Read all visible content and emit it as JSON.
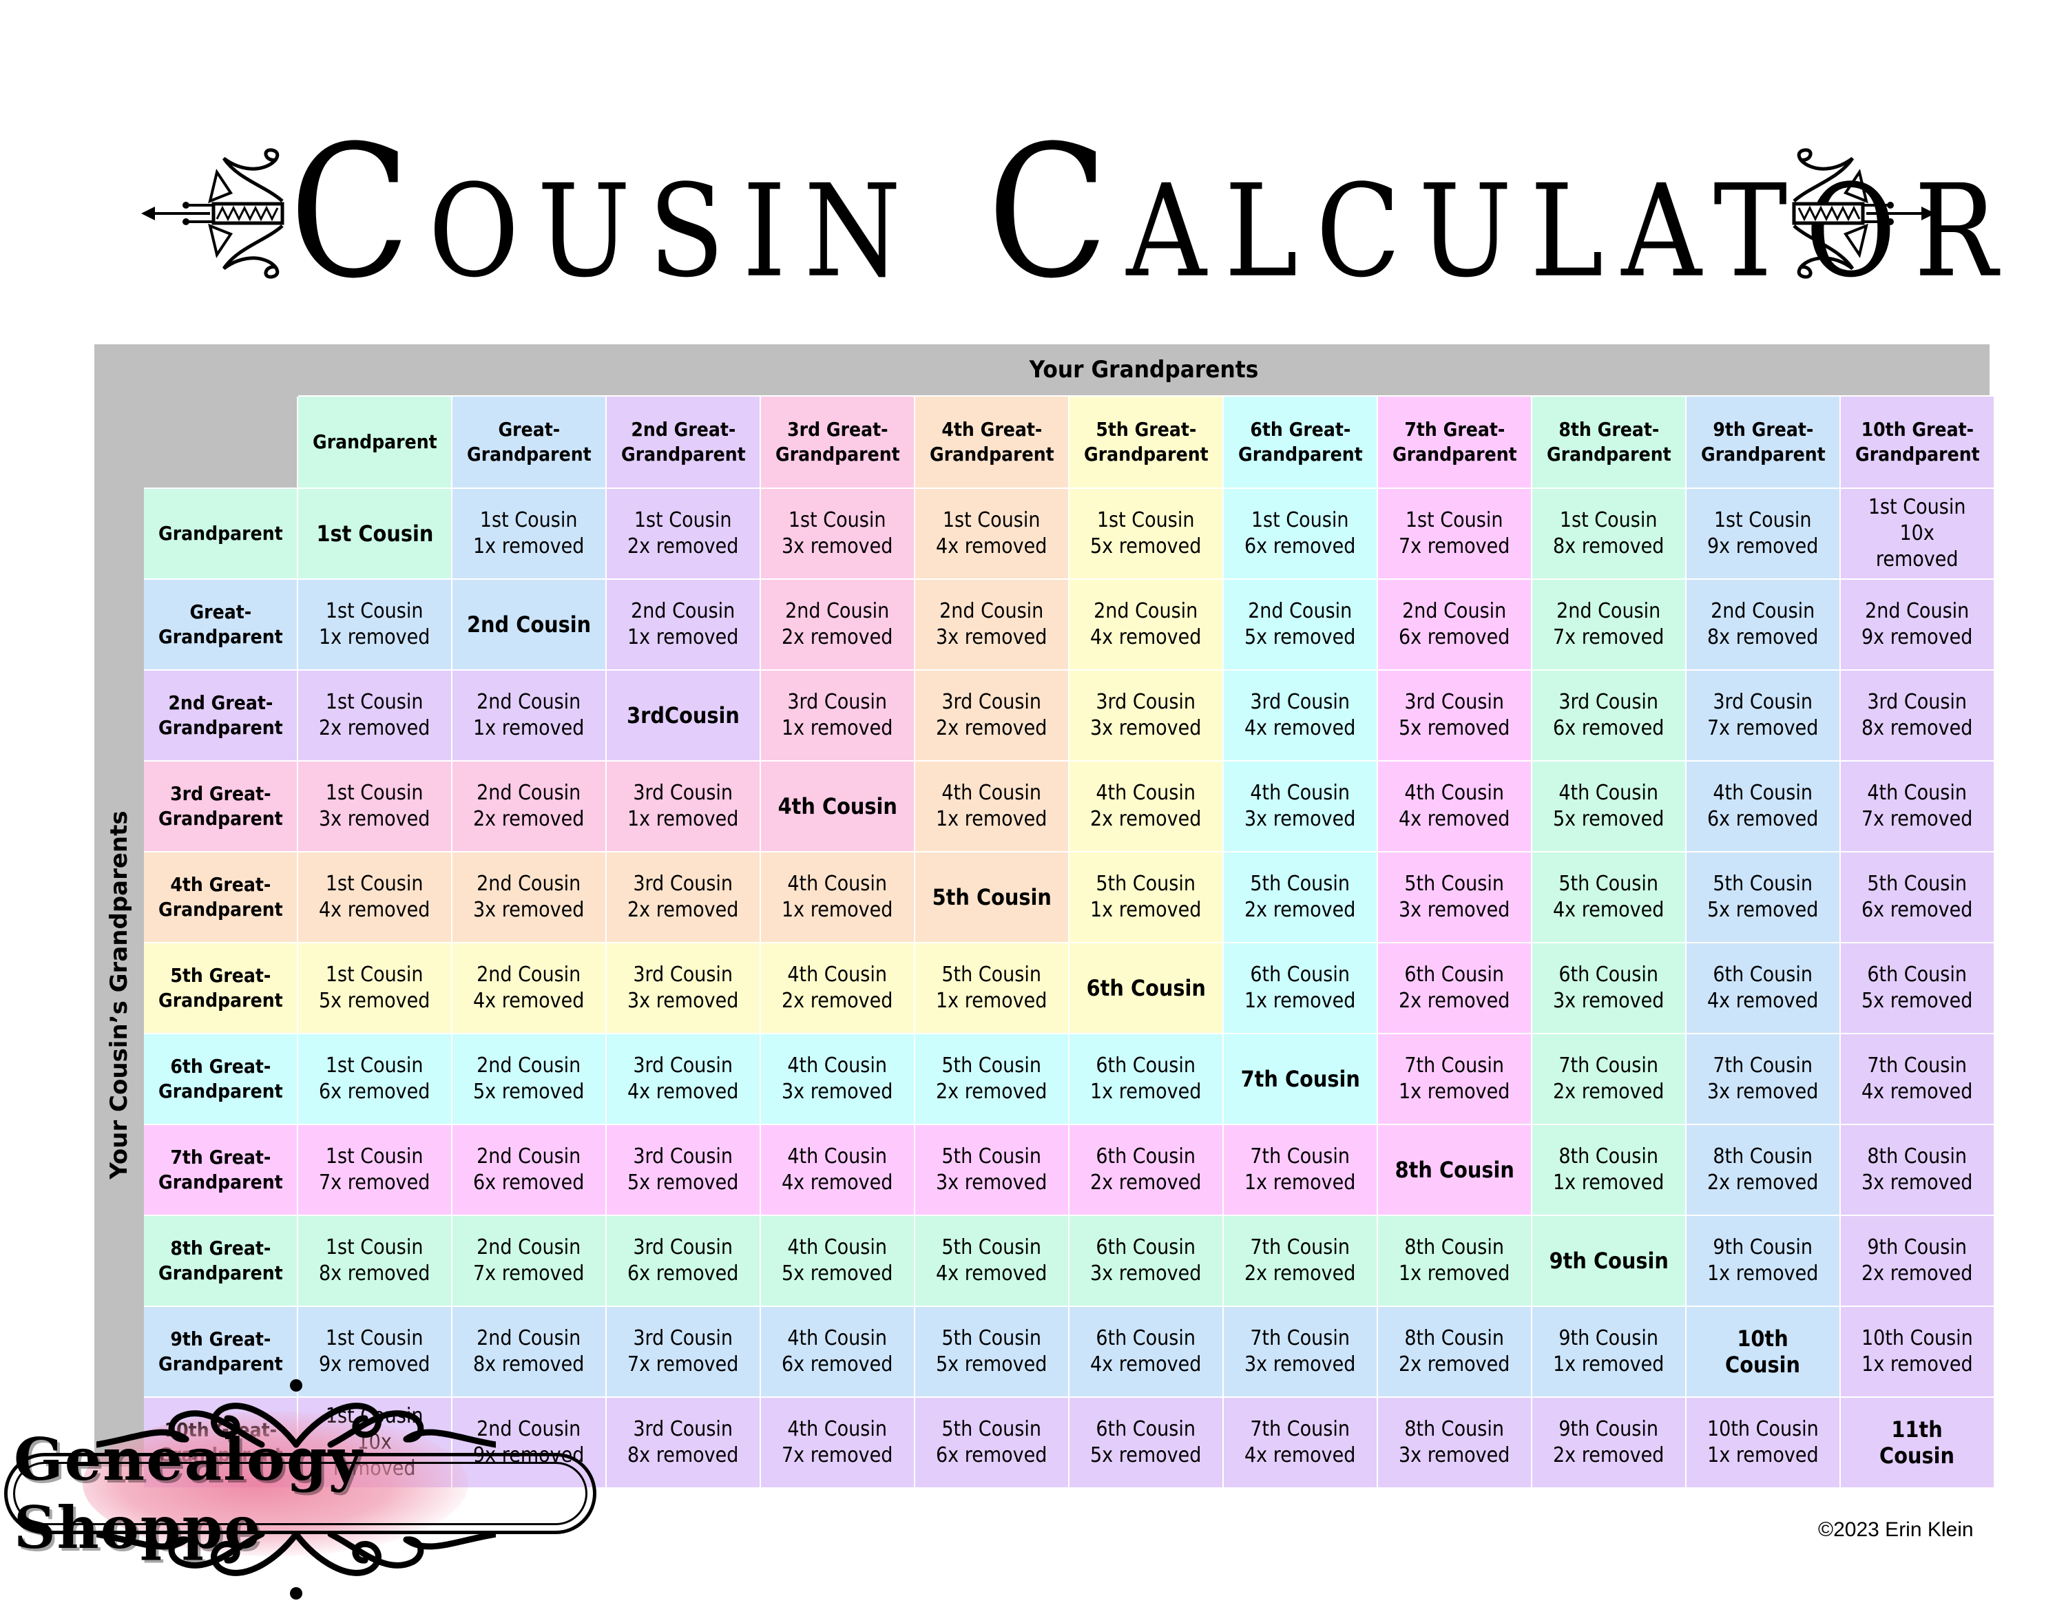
{
  "title": "Cousin Calculator",
  "axes": {
    "top_label": "Your Grandparents",
    "side_label": "Your Cousin’s Grandparents"
  },
  "column_headers": [
    "Grandparent",
    "Great-\nGrandparent",
    "2nd Great-\nGrandparent",
    "3rd Great-\nGrandparent",
    "4th Great-\nGrandparent",
    "5th Great-\nGrandparent",
    "6th Great-\nGrandparent",
    "7th Great-\nGrandparent",
    "8th Great-\nGrandparent",
    "9th Great-\nGrandparent",
    "10th Great-\nGrandparent"
  ],
  "row_headers": [
    "Grandparent",
    "Great-\nGrandparent",
    "2nd Great-\nGrandparent",
    "3rd Great-\nGrandparent",
    "4th Great-\nGrandparent",
    "5th Great-\nGrandparent",
    "6th Great-\nGrandparent",
    "7th Great-\nGrandparent",
    "8th Great-\nGrandparent",
    "9th Great-\nGrandparent",
    "10th Great-\nGrandparent"
  ],
  "level_colors": [
    "#ccfae6",
    "#cce4fa",
    "#e3cdfa",
    "#fccbe6",
    "#fde3cc",
    "#fefccc",
    "#ccfefe",
    "#fecafe",
    "#ccfae6",
    "#cce4fa",
    "#e3cdfa"
  ],
  "cells": [
    [
      "1st Cousin",
      "1st Cousin\n1x removed",
      "1st Cousin\n2x removed",
      "1st Cousin\n3x removed",
      "1st Cousin\n4x removed",
      "1st Cousin\n5x removed",
      "1st Cousin\n6x removed",
      "1st Cousin\n7x removed",
      "1st Cousin\n8x removed",
      "1st Cousin\n9x removed",
      "1st Cousin\n10x\nremoved"
    ],
    [
      "1st Cousin\n1x removed",
      "2nd Cousin",
      "2nd Cousin\n1x removed",
      "2nd Cousin\n2x removed",
      "2nd Cousin\n3x removed",
      "2nd Cousin\n4x removed",
      "2nd Cousin\n5x removed",
      "2nd Cousin\n6x removed",
      "2nd Cousin\n7x removed",
      "2nd Cousin\n8x removed",
      "2nd Cousin\n9x removed"
    ],
    [
      "1st Cousin\n2x removed",
      "2nd Cousin\n1x removed",
      "3rdCousin",
      "3rd Cousin\n1x removed",
      "3rd Cousin\n2x removed",
      "3rd Cousin\n3x removed",
      "3rd Cousin\n4x removed",
      "3rd Cousin\n5x removed",
      "3rd Cousin\n6x removed",
      "3rd Cousin\n7x removed",
      "3rd Cousin\n8x removed"
    ],
    [
      "1st Cousin\n3x removed",
      "2nd Cousin\n2x removed",
      "3rd Cousin\n1x removed",
      "4th Cousin",
      "4th Cousin\n1x removed",
      "4th Cousin\n2x removed",
      "4th Cousin\n3x removed",
      "4th Cousin\n4x removed",
      "4th Cousin\n5x removed",
      "4th Cousin\n6x removed",
      "4th Cousin\n7x removed"
    ],
    [
      "1st Cousin\n4x removed",
      "2nd Cousin\n3x removed",
      "3rd Cousin\n2x removed",
      "4th Cousin\n1x removed",
      "5th Cousin",
      "5th Cousin\n1x removed",
      "5th Cousin\n2x removed",
      "5th Cousin\n3x removed",
      "5th Cousin\n4x removed",
      "5th Cousin\n5x removed",
      "5th Cousin\n6x removed"
    ],
    [
      "1st Cousin\n5x removed",
      "2nd Cousin\n4x removed",
      "3rd Cousin\n3x removed",
      "4th Cousin\n2x removed",
      "5th Cousin\n1x removed",
      "6th Cousin",
      "6th Cousin\n1x removed",
      "6th Cousin\n2x removed",
      "6th Cousin\n3x removed",
      "6th Cousin\n4x removed",
      "6th Cousin\n5x removed"
    ],
    [
      "1st Cousin\n6x removed",
      "2nd Cousin\n5x removed",
      "3rd Cousin\n4x removed",
      "4th Cousin\n3x removed",
      "5th Cousin\n2x removed",
      "6th Cousin\n1x removed",
      "7th Cousin",
      "7th Cousin\n1x removed",
      "7th Cousin\n2x removed",
      "7th Cousin\n3x removed",
      "7th Cousin\n4x removed"
    ],
    [
      "1st Cousin\n7x removed",
      "2nd Cousin\n6x removed",
      "3rd Cousin\n5x removed",
      "4th Cousin\n4x removed",
      "5th Cousin\n3x removed",
      "6th Cousin\n2x removed",
      "7th Cousin\n1x removed",
      "8th Cousin",
      "8th Cousin\n1x removed",
      "8th Cousin\n2x removed",
      "8th Cousin\n3x removed"
    ],
    [
      "1st Cousin\n8x removed",
      "2nd Cousin\n7x removed",
      "3rd Cousin\n6x removed",
      "4th Cousin\n5x removed",
      "5th Cousin\n4x removed",
      "6th Cousin\n3x removed",
      "7th Cousin\n2x removed",
      "8th Cousin\n1x removed",
      "9th Cousin",
      "9th Cousin\n1x removed",
      "9th Cousin\n2x removed"
    ],
    [
      "1st Cousin\n9x removed",
      "2nd Cousin\n8x removed",
      "3rd Cousin\n7x removed",
      "4th Cousin\n6x removed",
      "5th Cousin\n5x removed",
      "6th Cousin\n4x removed",
      "7th Cousin\n3x removed",
      "8th Cousin\n2x removed",
      "9th Cousin\n1x removed",
      "10th\nCousin",
      "10th Cousin\n1x removed"
    ],
    [
      "1st Cousin\n10x\nremoved",
      "2nd Cousin\n9x removed",
      "3rd Cousin\n8x removed",
      "4th Cousin\n7x removed",
      "5th Cousin\n6x removed",
      "6th Cousin\n5x removed",
      "7th Cousin\n4x removed",
      "8th Cousin\n3x removed",
      "9th Cousin\n2x removed",
      "10th Cousin\n1x removed",
      "11th\nCousin"
    ]
  ],
  "logo": {
    "text": "Genealogy Shoppe"
  },
  "footer": {
    "copyright": "©2023 Erin Klein"
  }
}
